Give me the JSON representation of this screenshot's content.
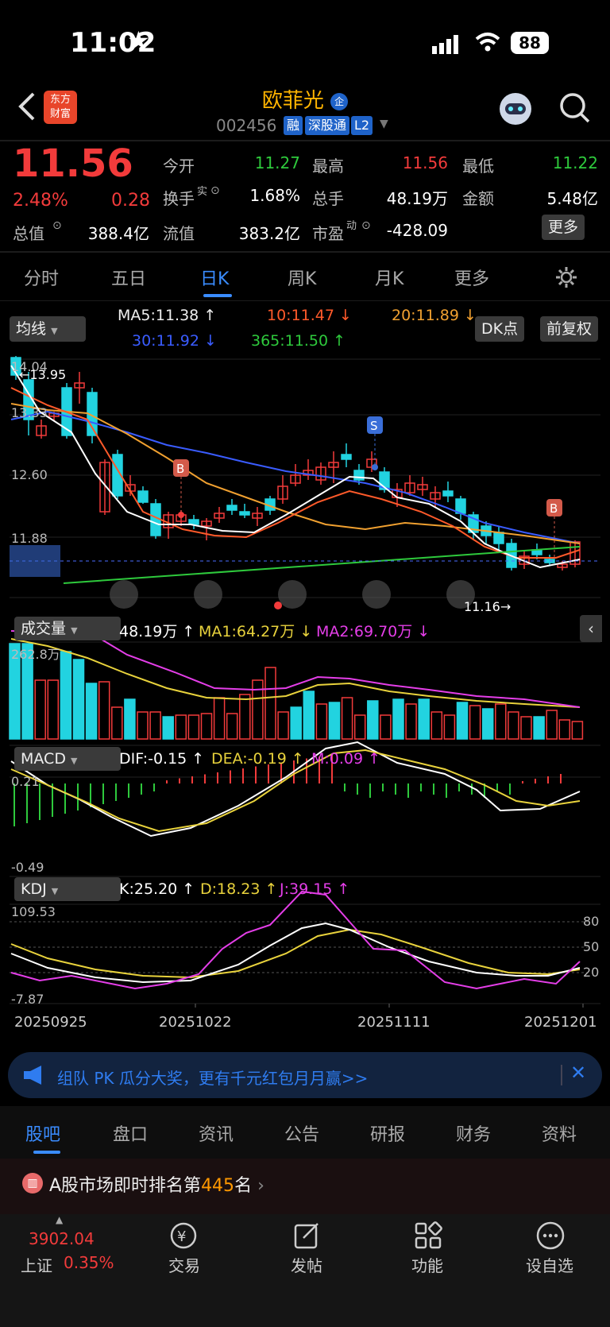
{
  "status": {
    "time": "11:02",
    "battery": "88"
  },
  "header": {
    "logo_line1": "东方",
    "logo_line2": "财富",
    "title": "欧菲光",
    "title_badge": "企",
    "code": "002456",
    "tags": [
      "融",
      "深股通",
      "L2"
    ]
  },
  "quote": {
    "price": "11.56",
    "change_pct": "2.48%",
    "change": "0.28",
    "open_label": "今开",
    "open": "11.27",
    "high_label": "最高",
    "high": "11.56",
    "low_label": "最低",
    "low": "11.22",
    "turnover_label": "换手",
    "turnover_sup": "实",
    "turnover": "1.68%",
    "volume_label": "总手",
    "volume": "48.19万",
    "amount_label": "金额",
    "amount": "5.48亿",
    "mcap_label": "总值",
    "mcap": "388.4亿",
    "float_label": "流值",
    "float": "383.2亿",
    "pe_label": "市盈",
    "pe_sup": "动",
    "pe": "-428.09",
    "more_label": "更多"
  },
  "tabs": [
    "分时",
    "五日",
    "日K",
    "周K",
    "月K",
    "更多"
  ],
  "active_tab": "日K",
  "ma_bar": {
    "selector": "均线",
    "ma5": "MA5:11.38 ↑",
    "ma10": "10:11.47 ↓",
    "ma20": "20:11.89 ↓",
    "ma30": "30:11.92 ↓",
    "ma365": "365:11.50 ↑",
    "dk_button": "DK点",
    "adjust_button": "前复权"
  },
  "kline": {
    "y_labels": [
      "14.04",
      "13.33",
      "12.60",
      "11.88"
    ],
    "high_mark": "13.95",
    "low_mark": "11.16",
    "signals": [
      "B",
      "S",
      "B"
    ]
  },
  "volume": {
    "selector": "成交量",
    "value": "48.19万 ↑",
    "ma1": "MA1:64.27万 ↓",
    "ma2": "MA2:69.70万 ↓",
    "max_label": "262.8万"
  },
  "macd": {
    "selector": "MACD",
    "dif": "DIF:-0.15 ↑",
    "dea": "DEA:-0.19 ↑",
    "m": "M:0.09 ↑",
    "top": "0.21",
    "bottom": "-0.49"
  },
  "kdj": {
    "selector": "KDJ",
    "k": "K:25.20 ↑",
    "d": "D:18.23 ↑",
    "j": "J:39.15 ↑",
    "top": "109.53",
    "bottom": "-7.87",
    "levels": [
      "80",
      "50",
      "20"
    ]
  },
  "dates": [
    "20250925",
    "20251022",
    "20251111",
    "20251201"
  ],
  "banner": {
    "text": "组队 PK 瓜分大奖，更有千元红包月月赢>>"
  },
  "bottom_tabs": [
    "股吧",
    "盘口",
    "资讯",
    "公告",
    "研报",
    "财务",
    "资料"
  ],
  "active_bottom_tab": "股吧",
  "rank": {
    "prefix": "A股市场即时排名第",
    "number": "445",
    "suffix": "名"
  },
  "nav": {
    "index_value": "3902.04",
    "index_name": "上证",
    "index_change": "0.35%",
    "items": [
      "交易",
      "发帖",
      "功能",
      "设自选"
    ]
  },
  "colors": {
    "up": "#f23b3b",
    "down": "#22d3e0",
    "accent": "#ff9800",
    "active_tab": "#3a8cff"
  }
}
